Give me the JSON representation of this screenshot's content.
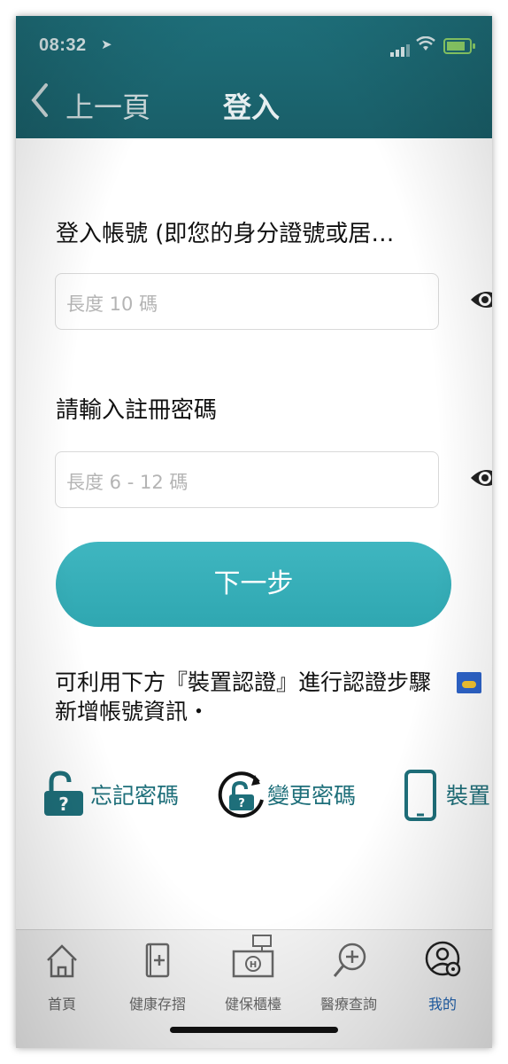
{
  "status_bar": {
    "time": "08:32"
  },
  "nav": {
    "back_label": "上一頁",
    "title": "登入"
  },
  "form": {
    "account_label": "登入帳號 (即您的身分證號或居…",
    "account_placeholder": "長度 10 碼",
    "password_label": "請輸入註冊密碼",
    "password_placeholder": "長度 6 - 12 碼",
    "next_button": "下一步"
  },
  "notice": {
    "text": "可利用下方『裝置認證』進行認證步驟新增帳號資訊・"
  },
  "quick_actions": [
    {
      "label": "忘記密碼",
      "icon": "unlock-question-icon"
    },
    {
      "label": "變更密碼",
      "icon": "unlock-refresh-icon"
    },
    {
      "label": "裝置",
      "icon": "phone-icon"
    }
  ],
  "tabbar": {
    "items": [
      {
        "label": "首頁",
        "icon": "home-icon"
      },
      {
        "label": "健康存摺",
        "icon": "health-book-icon"
      },
      {
        "label": "健保櫃檯",
        "icon": "counter-icon"
      },
      {
        "label": "醫療查詢",
        "icon": "medical-search-icon"
      },
      {
        "label": "我的",
        "icon": "profile-gear-icon",
        "active": true
      }
    ]
  },
  "colors": {
    "header": "#1e6f7a",
    "accent": "#3fb6c0",
    "active_tab": "#1f62b0"
  }
}
